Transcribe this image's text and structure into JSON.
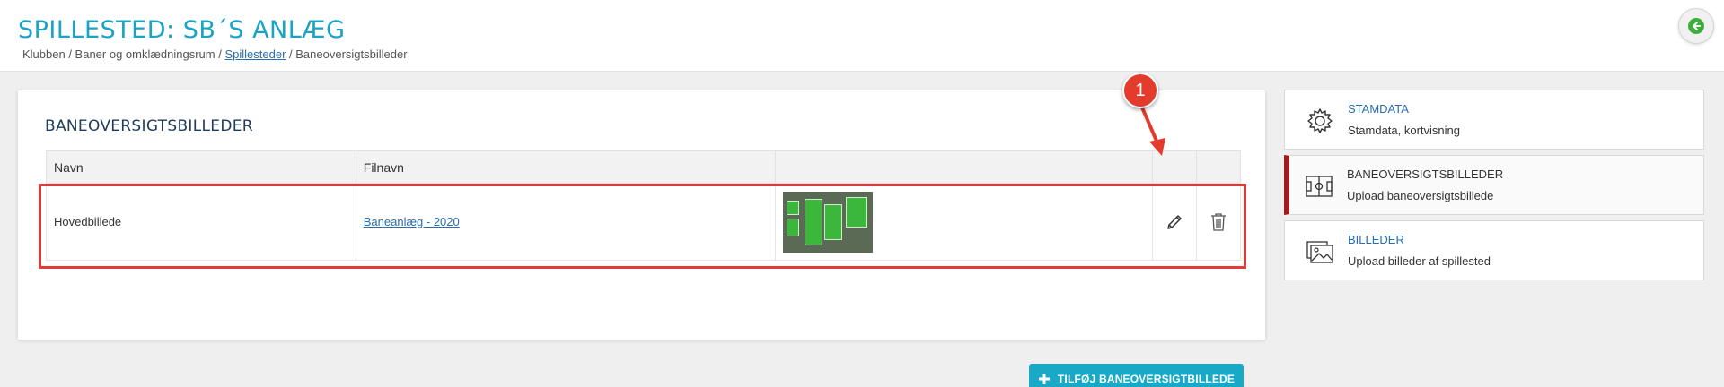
{
  "header": {
    "title": "SPILLESTED: SB´S ANLÆG",
    "breadcrumb": {
      "part1": "Klubben / Baner og omklædningsrum / ",
      "link": "Spillesteder",
      "part2": " / Baneoversigtsbilleder"
    }
  },
  "card": {
    "title": "BANEOVERSIGTSBILLEDER",
    "table": {
      "columns": [
        "Navn",
        "Filnavn",
        "",
        "",
        ""
      ],
      "rows": [
        {
          "navn": "Hovedbillede",
          "filnavn": "Baneanlæg - 2020"
        }
      ]
    },
    "add_button": "TILFØJ BANEOVERSIGTBILLEDE"
  },
  "annotation": {
    "marker": "1"
  },
  "sidebar": {
    "items": [
      {
        "title": "STAMDATA",
        "subtitle": "Stamdata, kortvisning",
        "icon": "gear-icon"
      },
      {
        "title": "BANEOVERSIGTSBILLEDER",
        "subtitle": "Upload baneoversigtsbillede",
        "icon": "field-layout-icon"
      },
      {
        "title": "BILLEDER",
        "subtitle": "Upload billeder af spillested",
        "icon": "images-icon"
      }
    ]
  },
  "colors": {
    "accent": "#1aa3c4",
    "active_border": "#a01c1c",
    "highlight": "#e03a3a",
    "button": "#19a9c6"
  }
}
